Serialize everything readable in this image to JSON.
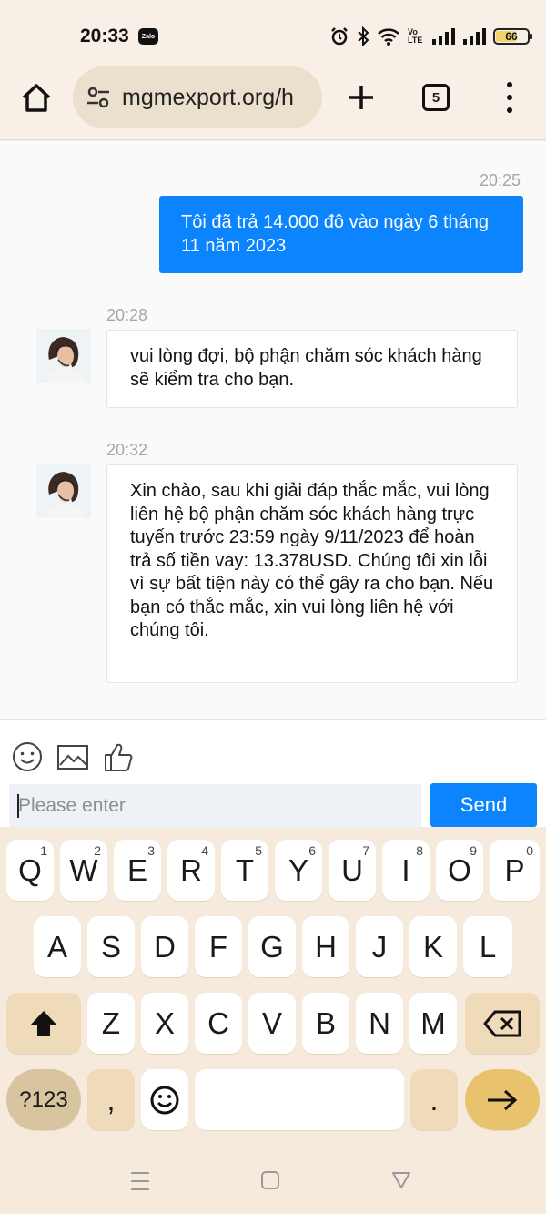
{
  "status_bar": {
    "time": "20:33",
    "notification_app": "Zalo",
    "battery_level": "66",
    "network_label": "Vo LTE"
  },
  "browser": {
    "url": "mgmexport.org/h",
    "tab_count": "5"
  },
  "chat": {
    "messages": [
      {
        "direction": "outgoing",
        "time": "20:25",
        "text": "Tôi đã trả 14.000 đô vào ngày 6 tháng 11 năm 2023"
      },
      {
        "direction": "incoming",
        "time": "20:28",
        "text": "vui lòng đợi, bộ phận chăm sóc khách hàng sẽ kiểm tra cho bạn."
      },
      {
        "direction": "incoming",
        "time": "20:32",
        "text": "Xin chào, sau khi giải đáp thắc mắc, vui lòng liên hệ bộ phận chăm sóc khách hàng trực tuyến trước 23:59 ngày 9/11/2023 để hoàn trả số tiền vay: 13.378USD. Chúng tôi xin lỗi vì sự bất tiện này có thể gây ra cho bạn. Nếu bạn có thắc mắc, xin vui lòng liên hệ với chúng tôi."
      }
    ],
    "tools": [
      "emoji-icon",
      "image-icon",
      "thumbs-up-icon"
    ],
    "input_placeholder": "Please enter",
    "send_label": "Send"
  },
  "keyboard": {
    "row1": [
      {
        "label": "Q",
        "hint": "1"
      },
      {
        "label": "W",
        "hint": "2"
      },
      {
        "label": "E",
        "hint": "3"
      },
      {
        "label": "R",
        "hint": "4"
      },
      {
        "label": "T",
        "hint": "5"
      },
      {
        "label": "Y",
        "hint": "6"
      },
      {
        "label": "U",
        "hint": "7"
      },
      {
        "label": "I",
        "hint": "8"
      },
      {
        "label": "O",
        "hint": "9"
      },
      {
        "label": "P",
        "hint": "0"
      }
    ],
    "row2": [
      "A",
      "S",
      "D",
      "F",
      "G",
      "H",
      "J",
      "K",
      "L"
    ],
    "row3": [
      "Z",
      "X",
      "C",
      "V",
      "B",
      "N",
      "M"
    ],
    "symbols_label": "?123",
    "comma_label": ",",
    "period_label": "."
  }
}
